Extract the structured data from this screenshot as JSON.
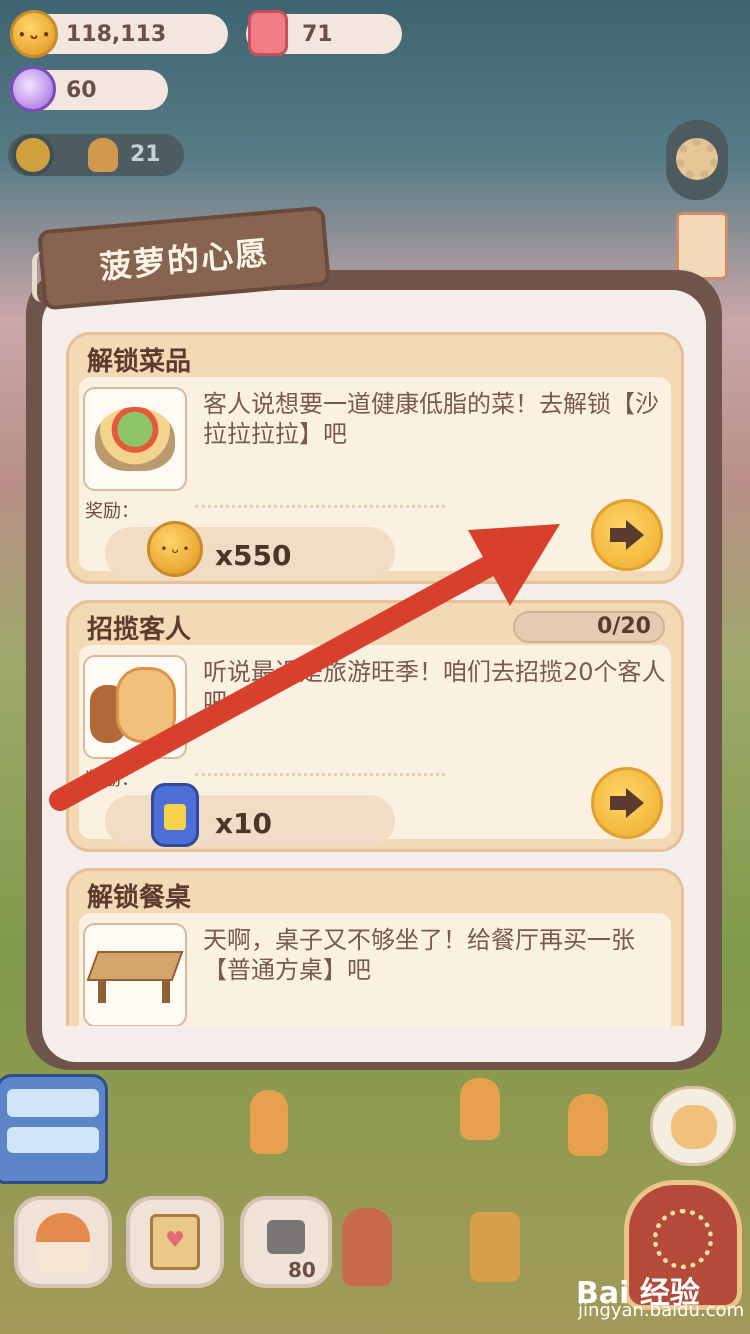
{
  "hud": {
    "coins": "118,113",
    "gems": "71",
    "candy": "60",
    "visitors": "21",
    "lock_cost": "80"
  },
  "dialog": {
    "title": "菠萝的心愿",
    "reward_label": "奖励：",
    "tasks": [
      {
        "title": "解锁菜品",
        "description": "客人说想要一道健康低脂的菜！去解锁【沙拉拉拉拉】吧",
        "reward": "x550",
        "reward_icon": "cookie-coin-icon",
        "thumb_icon": "salad-dish-icon"
      },
      {
        "title": "招揽客人",
        "progress": "0/20",
        "description": "听说最近是旅游旺季！咱们去招揽20个客人吧~",
        "reward": "x10",
        "reward_icon": "energy-jar-icon",
        "thumb_icon": "gingerbread-guests-icon"
      },
      {
        "title": "解锁餐桌",
        "description": "天啊，桌子又不够坐了！给餐厅再买一张【普通方桌】吧",
        "thumb_icon": "wooden-table-icon"
      }
    ]
  },
  "watermark": {
    "brand": "Bai 经验",
    "url": "jingyan.baidu.com"
  },
  "colors": {
    "panel_border": "#6e544a",
    "panel_bg": "#f5ede9",
    "card_bg": "#f4d9b5",
    "go_button": "#f3b93d",
    "arrow": "#d7402c"
  }
}
